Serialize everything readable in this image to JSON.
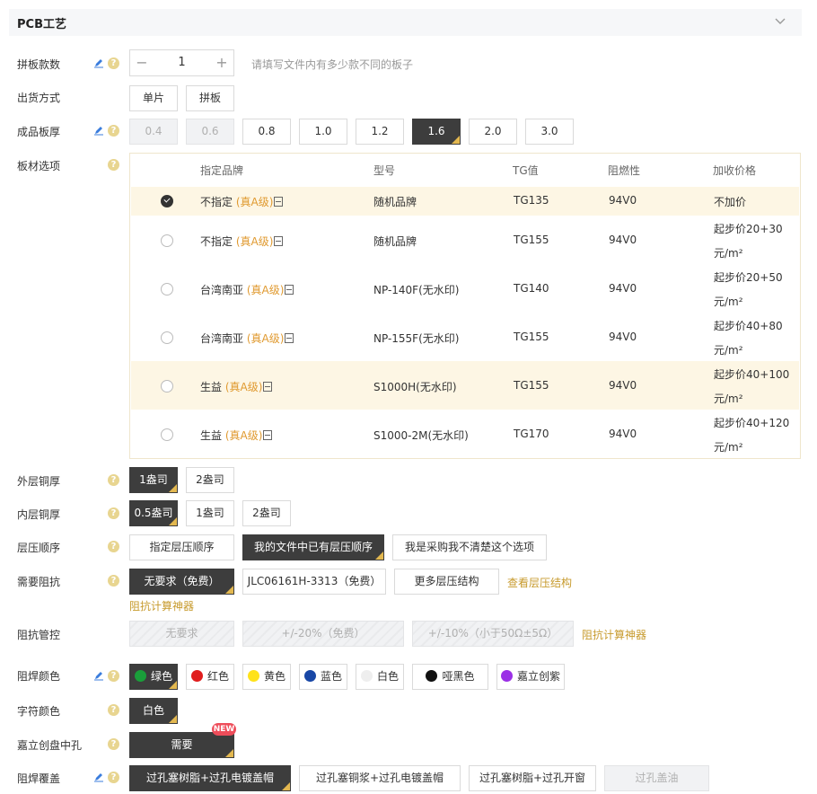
{
  "section": {
    "title": "PCB工艺"
  },
  "rows": {
    "panel_count": {
      "label": "拼板款数",
      "value": "1",
      "minus": "−",
      "plus": "+",
      "hint": "请填写文件内有多少款不同的板子"
    },
    "delivery": {
      "label": "出货方式",
      "options": [
        "单片",
        "拼板"
      ]
    },
    "thickness": {
      "label": "成品板厚",
      "options": [
        "0.4",
        "0.6",
        "0.8",
        "1.0",
        "1.2",
        "1.6",
        "2.0",
        "3.0"
      ],
      "selected": "1.6",
      "disabled": [
        "0.4",
        "0.6"
      ]
    },
    "material": {
      "label": "板材选项",
      "headers": [
        "指定品牌",
        "型号",
        "TG值",
        "阻燃性",
        "加收价格"
      ],
      "tag": "(真A级)",
      "rows": [
        {
          "brand": "不指定",
          "model": "随机品牌",
          "tg": "TG135",
          "fr": "94V0",
          "price1": "不加价",
          "price2": "",
          "selected": true
        },
        {
          "brand": "不指定",
          "model": "随机品牌",
          "tg": "TG155",
          "fr": "94V0",
          "price1": "起步价20+30",
          "price2": "元/m²",
          "selected": false
        },
        {
          "brand": "台湾南亚",
          "model": "NP-140F(无水印)",
          "tg": "TG140",
          "fr": "94V0",
          "price1": "起步价20+50",
          "price2": "元/m²",
          "selected": false
        },
        {
          "brand": "台湾南亚",
          "model": "NP-155F(无水印)",
          "tg": "TG155",
          "fr": "94V0",
          "price1": "起步价40+80",
          "price2": "元/m²",
          "selected": false
        },
        {
          "brand": "生益",
          "model": "S1000H(无水印)",
          "tg": "TG155",
          "fr": "94V0",
          "price1": "起步价40+100",
          "price2": "元/m²",
          "selected": false
        },
        {
          "brand": "生益",
          "model": "S1000-2M(无水印)",
          "tg": "TG170",
          "fr": "94V0",
          "price1": "起步价40+120",
          "price2": "元/m²",
          "selected": false
        }
      ]
    },
    "outer_copper": {
      "label": "外层铜厚",
      "options": [
        "1盎司",
        "2盎司"
      ],
      "selected": "1盎司"
    },
    "inner_copper": {
      "label": "内层铜厚",
      "options": [
        "0.5盎司",
        "1盎司",
        "2盎司"
      ],
      "selected": "0.5盎司"
    },
    "stackup_order": {
      "label": "层压顺序",
      "options": [
        "指定层压顺序",
        "我的文件中已有层压顺序",
        "我是采购我不清楚这个选项"
      ],
      "selected": "我的文件中已有层压顺序"
    },
    "impedance": {
      "label": "需要阻抗",
      "options": [
        "无要求（免费）",
        "JLC06161H-3313（免费）",
        "更多层压结构"
      ],
      "selected": "无要求（免费）",
      "link1": "查看层压结构",
      "link2": "阻抗计算神器"
    },
    "impedance_ctrl": {
      "label": "阻抗管控",
      "options": [
        "无要求",
        "+/-20%（免费）",
        "+/-10%（小于50Ω±5Ω）"
      ],
      "link": "阻抗计算神器"
    },
    "mask_color": {
      "label": "阻焊颜色",
      "options": [
        {
          "name": "绿色",
          "color": "#1a9e3a"
        },
        {
          "name": "红色",
          "color": "#e01d1d"
        },
        {
          "name": "黄色",
          "color": "#ffe21a"
        },
        {
          "name": "蓝色",
          "color": "#1847a6"
        },
        {
          "name": "白色",
          "color": "#eeeeee"
        },
        {
          "name": "哑黑色",
          "color": "#111111"
        },
        {
          "name": "嘉立创紫",
          "color": "#9b30e6"
        }
      ],
      "selected": "绿色"
    },
    "silk_color": {
      "label": "字符颜色",
      "options": [
        "白色"
      ],
      "selected": "白色"
    },
    "via_in_pad": {
      "label": "嘉立创盘中孔",
      "options": [
        "需要"
      ],
      "badge": "NEW",
      "selected": "需要"
    },
    "mask_cover": {
      "label": "阻焊覆盖",
      "options": [
        "过孔塞树脂+过孔电镀盖帽",
        "过孔塞铜浆+过孔电镀盖帽",
        "过孔塞树脂+过孔开窗",
        "过孔盖油"
      ],
      "selected": "过孔塞树脂+过孔电镀盖帽",
      "disabled": [
        "过孔盖油"
      ]
    }
  },
  "icons": {
    "edit": "pencil-icon",
    "help": "help-icon",
    "collapse": "chevron-down-icon"
  },
  "colors": {
    "selected_bg": "#3d3d3d",
    "corner_mark": "#e3b850",
    "accent_link": "#c79a2c",
    "row_highlight": "#fdf6e4",
    "help_icon": "#e8d590"
  }
}
